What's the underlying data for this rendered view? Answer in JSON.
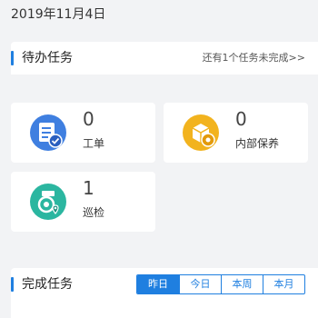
{
  "header": {
    "date": "2019年11月4日"
  },
  "pending": {
    "title": "待办任务",
    "more_text": "还有1个任务未完成>>",
    "cards": [
      {
        "count": "0",
        "label": "工单",
        "icon": "work-order-icon",
        "color": "#3f7fe0"
      },
      {
        "count": "0",
        "label": "内部保养",
        "icon": "maintenance-icon",
        "color": "#f2b31e"
      },
      {
        "count": "1",
        "label": "巡检",
        "icon": "inspection-icon",
        "color": "#2bb6a0"
      }
    ]
  },
  "completed": {
    "title": "完成任务",
    "tabs": [
      "昨日",
      "今日",
      "本周",
      "本月"
    ],
    "active_tab": "昨日"
  },
  "colors": {
    "accent": "#1f7fe0",
    "background": "#f2f3f5"
  }
}
